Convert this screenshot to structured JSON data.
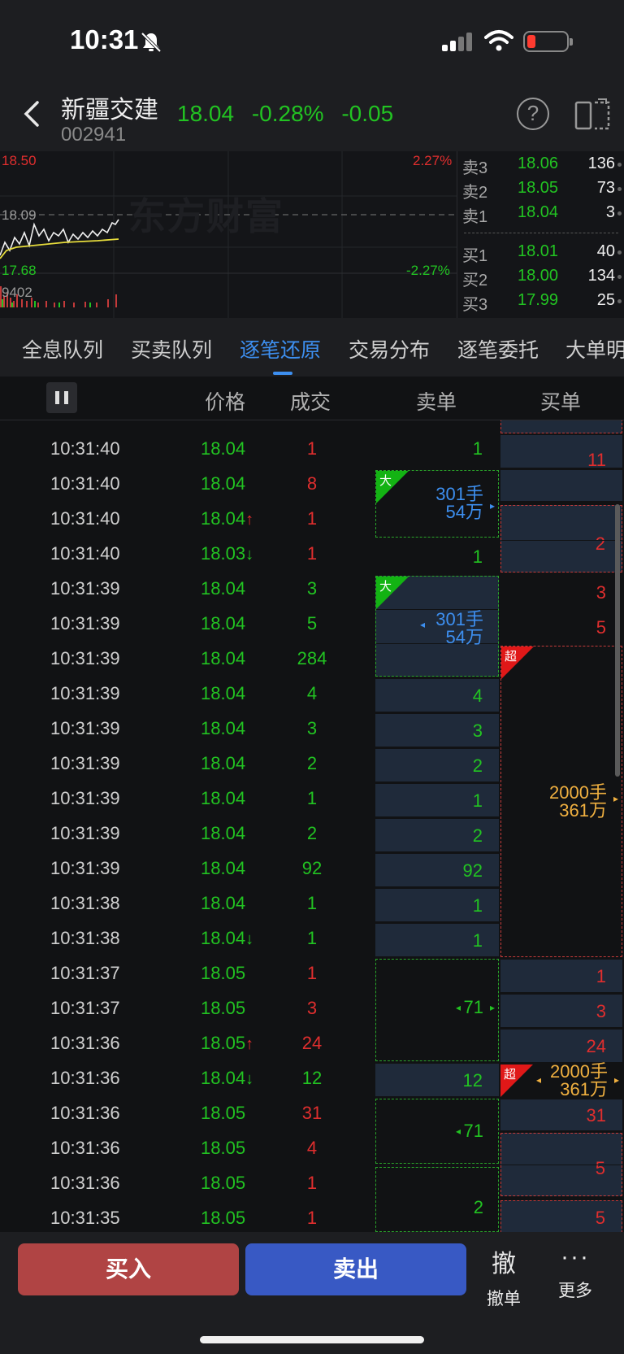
{
  "status_bar": {
    "time": "10:31"
  },
  "header": {
    "stock_name": "新疆交建",
    "stock_code": "002941",
    "price": "18.04",
    "change_pct": "-0.28%",
    "change": "-0.05"
  },
  "mini_chart": {
    "high": "18.50",
    "high_pct": "2.27%",
    "prev_close": "18.09",
    "low": "17.68",
    "low_pct": "-2.27%",
    "volume": "9402",
    "watermark": "东方财富"
  },
  "order_book": {
    "asks": [
      {
        "label": "卖3",
        "price": "18.06",
        "volume": "136"
      },
      {
        "label": "卖2",
        "price": "18.05",
        "volume": "73"
      },
      {
        "label": "卖1",
        "price": "18.04",
        "volume": "3"
      }
    ],
    "bids": [
      {
        "label": "买1",
        "price": "18.01",
        "volume": "40"
      },
      {
        "label": "买2",
        "price": "18.00",
        "volume": "134"
      },
      {
        "label": "买3",
        "price": "17.99",
        "volume": "25"
      }
    ]
  },
  "tabs": [
    "全息队列",
    "买卖队列",
    "逐笔还原",
    "交易分布",
    "逐笔委托",
    "大单明"
  ],
  "columns": {
    "price": "价格",
    "volume": "成交",
    "sell_orders": "卖单",
    "buy_orders": "买单"
  },
  "ticks": [
    {
      "time": "10:31:40",
      "price": "18.04",
      "arrow": "",
      "volume": "1",
      "color": "red"
    },
    {
      "time": "10:31:40",
      "price": "18.04",
      "arrow": "",
      "volume": "8",
      "color": "red"
    },
    {
      "time": "10:31:40",
      "price": "18.04",
      "arrow": "↑",
      "volume": "1",
      "color": "red"
    },
    {
      "time": "10:31:40",
      "price": "18.03",
      "arrow": "↓",
      "volume": "1",
      "color": "red"
    },
    {
      "time": "10:31:39",
      "price": "18.04",
      "arrow": "",
      "volume": "3",
      "color": "green"
    },
    {
      "time": "10:31:39",
      "price": "18.04",
      "arrow": "",
      "volume": "5",
      "color": "green"
    },
    {
      "time": "10:31:39",
      "price": "18.04",
      "arrow": "",
      "volume": "284",
      "color": "green"
    },
    {
      "time": "10:31:39",
      "price": "18.04",
      "arrow": "",
      "volume": "4",
      "color": "green"
    },
    {
      "time": "10:31:39",
      "price": "18.04",
      "arrow": "",
      "volume": "3",
      "color": "green"
    },
    {
      "time": "10:31:39",
      "price": "18.04",
      "arrow": "",
      "volume": "2",
      "color": "green"
    },
    {
      "time": "10:31:39",
      "price": "18.04",
      "arrow": "",
      "volume": "1",
      "color": "green"
    },
    {
      "time": "10:31:39",
      "price": "18.04",
      "arrow": "",
      "volume": "2",
      "color": "green"
    },
    {
      "time": "10:31:39",
      "price": "18.04",
      "arrow": "",
      "volume": "92",
      "color": "green"
    },
    {
      "time": "10:31:38",
      "price": "18.04",
      "arrow": "",
      "volume": "1",
      "color": "green"
    },
    {
      "time": "10:31:38",
      "price": "18.04",
      "arrow": "↓",
      "volume": "1",
      "color": "green"
    },
    {
      "time": "10:31:37",
      "price": "18.05",
      "arrow": "",
      "volume": "1",
      "color": "red"
    },
    {
      "time": "10:31:37",
      "price": "18.05",
      "arrow": "",
      "volume": "3",
      "color": "red"
    },
    {
      "time": "10:31:36",
      "price": "18.05",
      "arrow": "↑",
      "volume": "24",
      "color": "red"
    },
    {
      "time": "10:31:36",
      "price": "18.04",
      "arrow": "↓",
      "volume": "12",
      "color": "green"
    },
    {
      "time": "10:31:36",
      "price": "18.05",
      "arrow": "",
      "volume": "31",
      "color": "red"
    },
    {
      "time": "10:31:36",
      "price": "18.05",
      "arrow": "",
      "volume": "4",
      "color": "red"
    },
    {
      "time": "10:31:36",
      "price": "18.05",
      "arrow": "",
      "volume": "1",
      "color": "red"
    },
    {
      "time": "10:31:35",
      "price": "18.05",
      "arrow": "",
      "volume": "1",
      "color": "red"
    }
  ],
  "sell_cells": {
    "c1": "1",
    "big1_top": "301手",
    "big1_bottom": "54万",
    "c2": "1",
    "big2_top": "301手",
    "big2_bottom": "54万",
    "c3": "4",
    "c4": "3",
    "c5": "2",
    "c6": "1",
    "c7": "2",
    "c8": "92",
    "c9": "1",
    "c10": "1",
    "c11": "71",
    "c12": "12",
    "c13": "71",
    "c14": "2",
    "badge_big": "大"
  },
  "buy_cells": {
    "c1": "11",
    "c2": "2",
    "c3": "3",
    "c4": "5",
    "super_top": "2000手",
    "super_bottom": "361万",
    "c5": "1",
    "c6": "3",
    "c7": "24",
    "super2_top": "2000手",
    "super2_bottom": "361万",
    "c8": "31",
    "c9": "5",
    "c10": "5",
    "badge_super": "超"
  },
  "bottom_bar": {
    "buy_label": "买入",
    "sell_label": "卖出",
    "cancel_glyph": "撤",
    "cancel_label": "撤单",
    "more_glyph": "···",
    "more_label": "更多"
  },
  "colors": {
    "up": "#e02e2e",
    "down": "#22c322",
    "accent": "#3d8ff0",
    "big_order": "#3d8ff0",
    "super_order": "#f0b040"
  }
}
